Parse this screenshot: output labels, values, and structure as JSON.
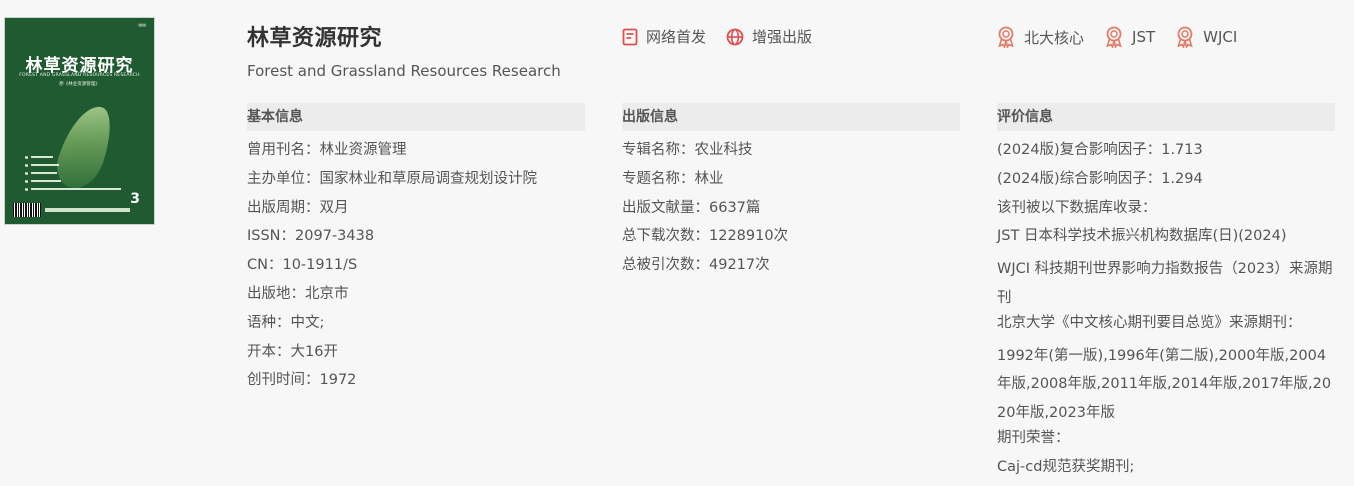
{
  "cover": {
    "title": "林草资源研究",
    "subtitle_en": "FOREST AND GRASSLAND RESOURCES RESEARCH",
    "subtitle_cn": "原《林业资源管理》",
    "issue_number": "3"
  },
  "journal": {
    "title_cn": "林草资源研究",
    "title_en": "Forest and Grassland Resources Research"
  },
  "publish_tags": [
    {
      "label": "网络首发",
      "icon": "document-icon"
    },
    {
      "label": "增强出版",
      "icon": "globe-icon"
    }
  ],
  "rank_tags": [
    {
      "label": "北大核心",
      "icon": "award-icon"
    },
    {
      "label": "JST",
      "icon": "award-icon"
    },
    {
      "label": "WJCI",
      "icon": "award-icon"
    }
  ],
  "basic_info": {
    "heading": "基本信息",
    "rows": [
      {
        "label": "曾用刊名：",
        "value": "林业资源管理"
      },
      {
        "label": "主办单位：",
        "value": "国家林业和草原局调查规划设计院"
      },
      {
        "label": "出版周期：",
        "value": "双月"
      },
      {
        "label": "ISSN：",
        "value": "2097-3438"
      },
      {
        "label": "CN：",
        "value": "10-1911/S"
      },
      {
        "label": "出版地：",
        "value": "北京市"
      },
      {
        "label": "语种：",
        "value": "中文;"
      },
      {
        "label": "开本：",
        "value": "大16开"
      },
      {
        "label": "创刊时间：",
        "value": "1972"
      }
    ]
  },
  "publish_info": {
    "heading": "出版信息",
    "rows": [
      {
        "label": "专辑名称：",
        "value": "农业科技"
      },
      {
        "label": "专题名称：",
        "value": "林业"
      },
      {
        "label": "出版文献量：",
        "value": "6637篇"
      },
      {
        "label": "总下载次数：",
        "value": "1228910次"
      },
      {
        "label": "总被引次数：",
        "value": "49217次"
      }
    ]
  },
  "eval_info": {
    "heading": "评价信息",
    "impact_composite": "(2024版)复合影响因子：1.713",
    "impact_comprehensive": "(2024版)综合影响因子：1.294",
    "db_heading": "该刊被以下数据库收录：",
    "db_jst": "JST 日本科学技术振兴机构数据库(日)(2024)",
    "db_wjci": "WJCI 科技期刊世界影响力指数报告（2023）来源期刊",
    "pku_heading": "北京大学《中文核心期刊要目总览》来源期刊：",
    "pku_years": "1992年(第一版),1996年(第二版),2000年版,2004年版,2008年版,2011年版,2014年版,2017年版,2020年版,2023年版",
    "honor_heading": "期刊荣誉：",
    "honor_value": "Caj-cd规范获奖期刊;"
  },
  "colors": {
    "accent": "#e04f4f",
    "cover_green": "#1f5a31",
    "header_bg": "#ececec"
  }
}
